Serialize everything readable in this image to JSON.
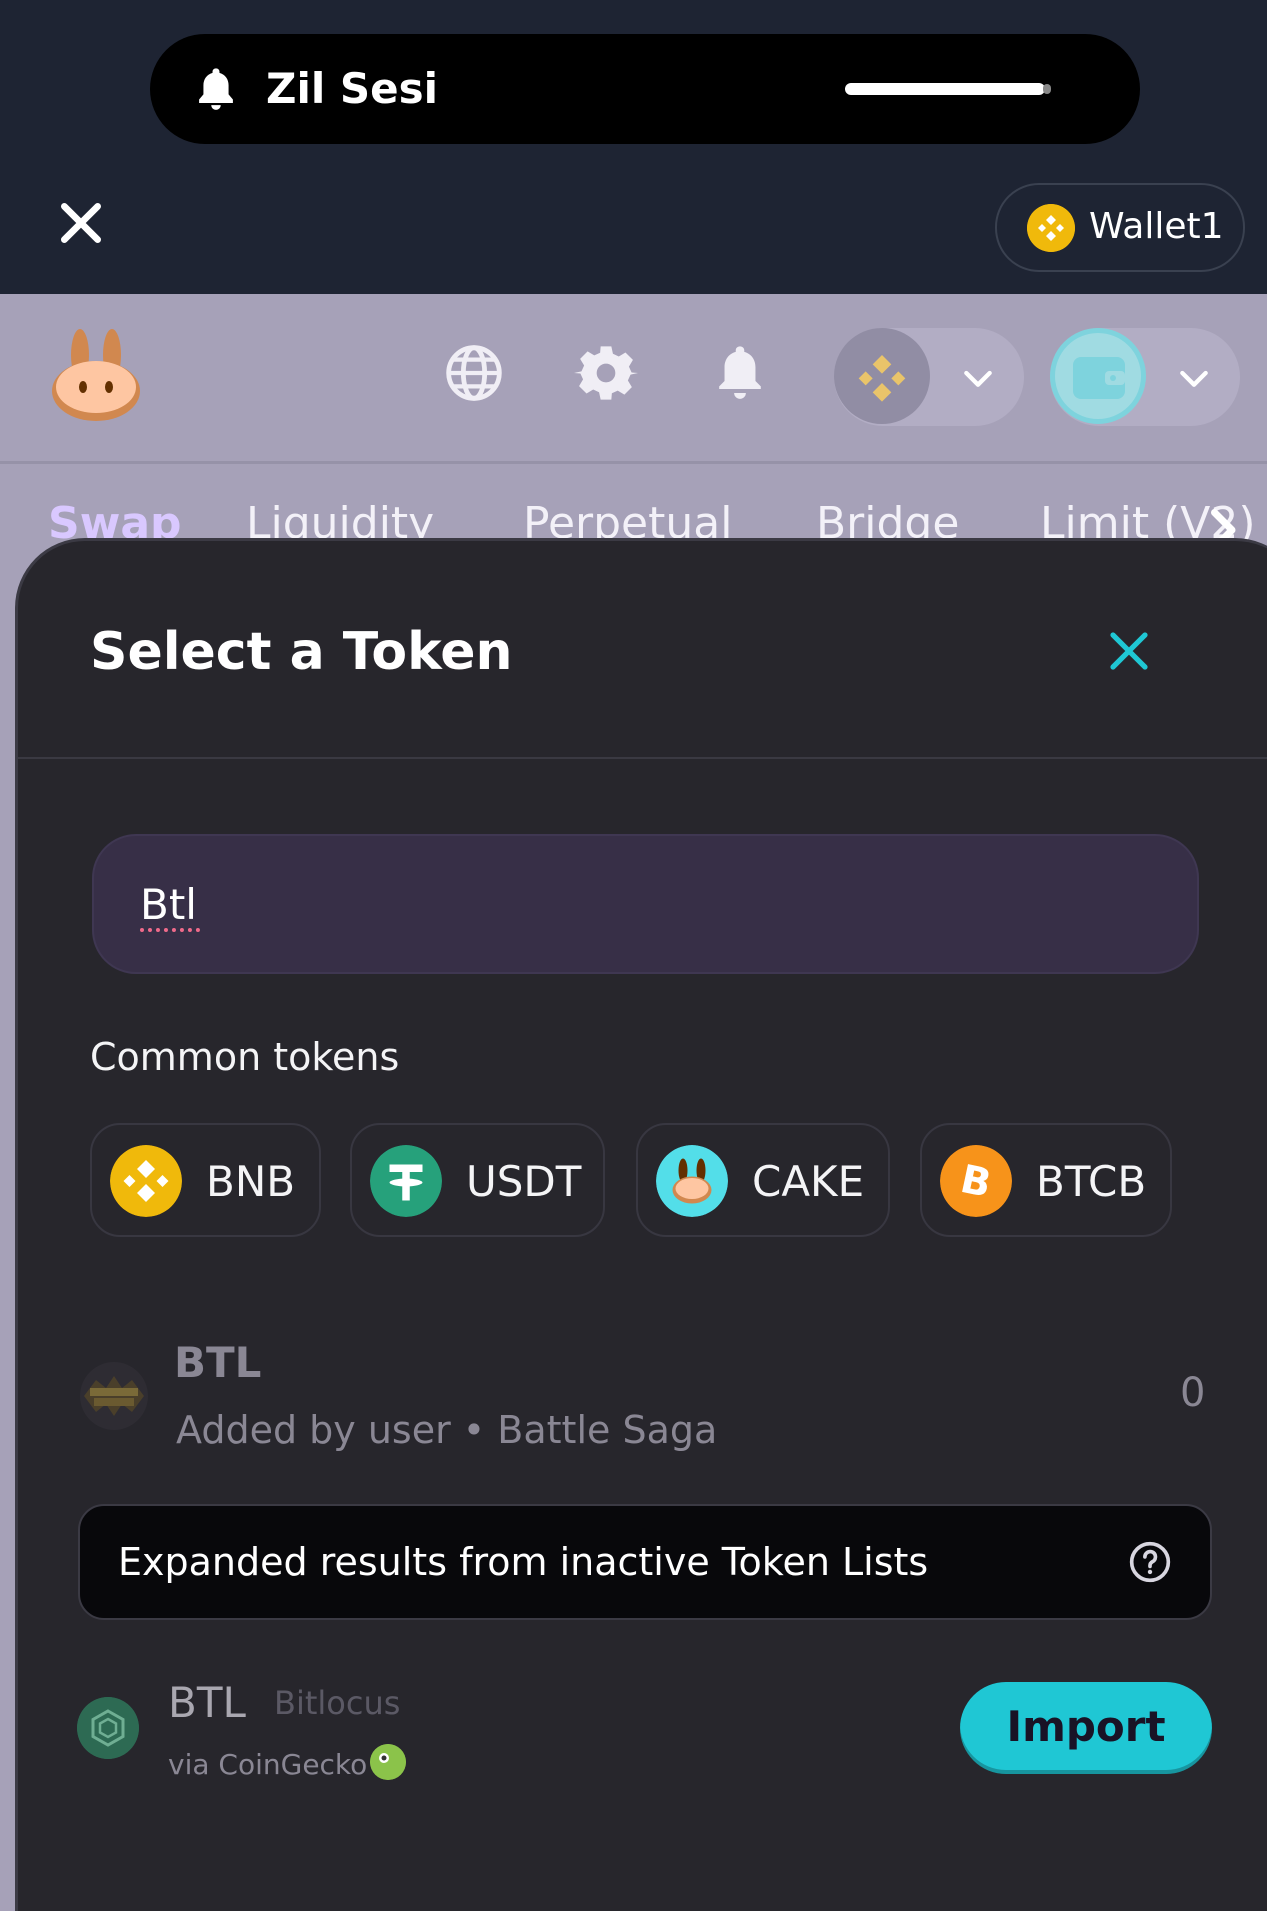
{
  "status_call": {
    "title": "Zil Sesi"
  },
  "browser": {
    "wallet_label": "Wallet1"
  },
  "nav": {
    "tabs": [
      {
        "label": "Swap",
        "active": true
      },
      {
        "label": "Liquidity",
        "active": false
      },
      {
        "label": "Perpetual",
        "active": false
      },
      {
        "label": "Bridge",
        "active": false
      },
      {
        "label": "Limit (V2)",
        "active": false
      }
    ]
  },
  "modal": {
    "title": "Select a Token",
    "search": {
      "value": "Btl"
    },
    "common_tokens_label": "Common tokens",
    "common_tokens": [
      {
        "symbol": "BNB",
        "icon": "bnb-icon",
        "color": "#f0b90b"
      },
      {
        "symbol": "USDT",
        "icon": "usdt-icon",
        "color": "#26a17b"
      },
      {
        "symbol": "CAKE",
        "icon": "cake-icon",
        "color": "#53dee9"
      },
      {
        "symbol": "BTCB",
        "icon": "btcb-icon",
        "color": "#f7931a"
      }
    ],
    "results": [
      {
        "symbol": "BTL",
        "subtitle": "Added by user • Battle Saga",
        "balance": "0"
      }
    ],
    "expanded_label": "Expanded results from inactive Token Lists",
    "inactive_results": [
      {
        "symbol": "BTL",
        "name": "Bitlocus",
        "via": "via CoinGecko",
        "action": "Import"
      }
    ]
  },
  "colors": {
    "accent": "#1fc7d4",
    "modal_bg": "#27262c",
    "search_bg": "#372f47"
  }
}
